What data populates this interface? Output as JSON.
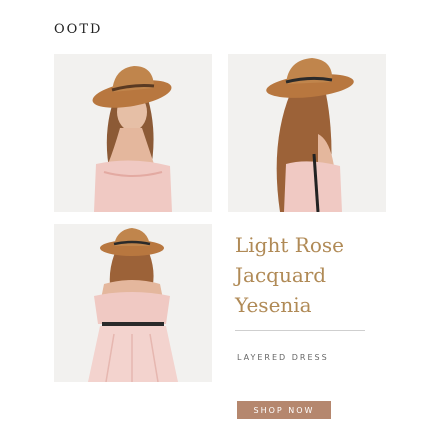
{
  "header": {
    "title": "OOTD"
  },
  "product": {
    "name_lines": [
      "Light Rose",
      "Jacquard",
      "Yesenia"
    ],
    "subtitle": "LAYERED DRESS",
    "cta_label": "SHOP NOW"
  },
  "colors": {
    "accent_text": "#b08a56",
    "button_bg": "#b5876e",
    "photo_bg": "#f2f1ef",
    "hat": "#b8773f",
    "dress": "#f0c9c3",
    "hair": "#8c5a36"
  },
  "photos": [
    {
      "icon": "model-front-photo"
    },
    {
      "icon": "model-side-photo"
    },
    {
      "icon": "model-back-photo"
    }
  ]
}
